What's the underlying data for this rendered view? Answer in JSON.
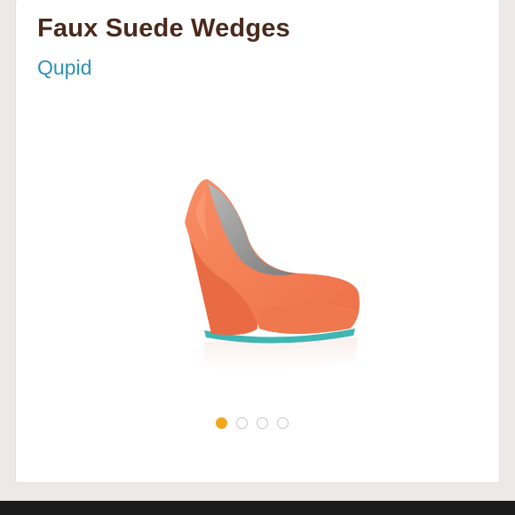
{
  "listing": {
    "title": "Faux Suede Wedges",
    "brand": "Qupid"
  },
  "product_image": {
    "subject": "orange faux suede wedge shoe",
    "colors": {
      "suede": "#f5825a",
      "sole": "#3fb6b4",
      "insole": "#9a9a9a"
    }
  },
  "carousel": {
    "total": 4,
    "active_index": 0,
    "active_color": "#f2a81d"
  },
  "colors": {
    "title": "#4a2a1c",
    "brand_link": "#2f8fb5",
    "page_background": "#eceae6",
    "bottom_bar": "#1c1c1c"
  }
}
